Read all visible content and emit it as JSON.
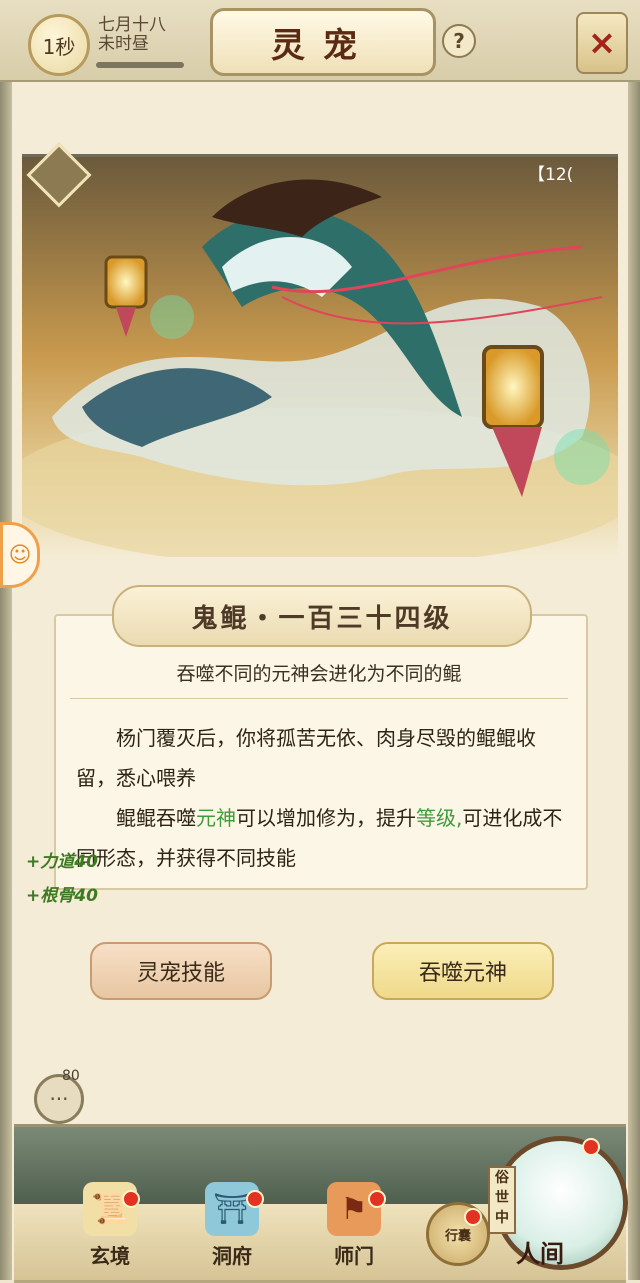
{
  "header": {
    "time_badge": "1秒",
    "date_line1": "七月十八",
    "date_line2": "未时昼",
    "title": "灵宠",
    "help_icon": "?",
    "close_icon": "×"
  },
  "artwork": {
    "counter": "【12("
  },
  "pet": {
    "name": "鬼鲲・一百三十四级",
    "subtitle": "吞噬不同的元神会进化为不同的鲲",
    "desc1": "杨门覆灭后，你将孤苦无依、肉身尽毁的鲲鲲收留，悉心喂养",
    "desc2_a": "鲲鲲吞噬",
    "desc2_hl1": "元神",
    "desc2_b": "可以增加修为，提升",
    "desc2_hl2": "等级,",
    "desc2_c": "可进化成不同形态，并获得不同技能"
  },
  "stats": {
    "line1": "+力道40",
    "line2": "+根骨40"
  },
  "buttons": {
    "skill": "灵宠技能",
    "devour": "吞噬元神"
  },
  "chat": {
    "count": "80"
  },
  "nav": {
    "items": [
      {
        "label": "玄境",
        "icon": "scroll-icon"
      },
      {
        "label": "洞府",
        "icon": "pavilion-icon"
      },
      {
        "label": "师门",
        "icon": "banner-icon"
      }
    ],
    "bag_label": "行囊",
    "world_tag": "俗世中",
    "world_label": "人间"
  },
  "colors": {
    "highlight": "#3f9b3a",
    "title": "#5b2a12",
    "badge": "#e23322"
  }
}
